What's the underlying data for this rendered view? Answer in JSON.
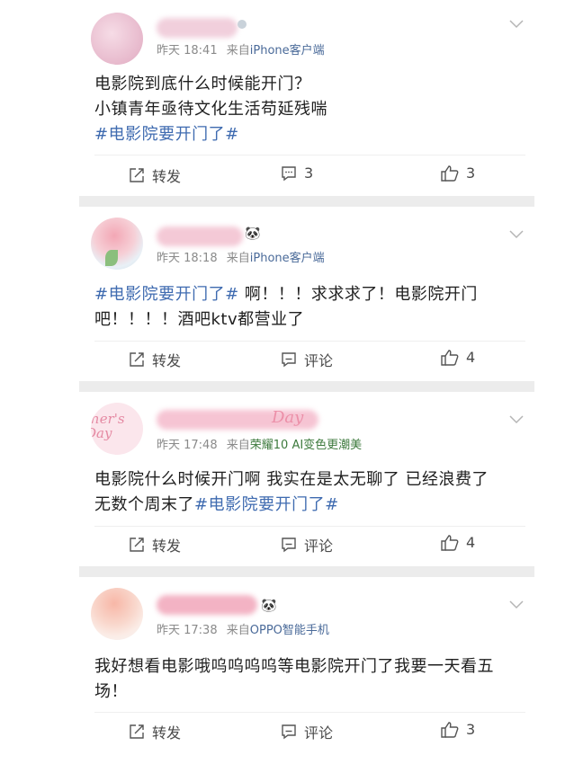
{
  "posts": [
    {
      "time": "昨天 18:41",
      "source_prefix": "来自",
      "source": "iPhone客户端",
      "content_lines": [
        "电影院到底什么时候能开门？",
        "小镇青年亟待文化生活苟延残喘"
      ],
      "hashtag": "#电影院要开门了#",
      "share_label": "转发",
      "comment_label": "3",
      "like_count": "3"
    },
    {
      "time": "昨天 18:18",
      "source_prefix": "来自",
      "source": "iPhone客户端",
      "hashtag": "#电影院要开门了#",
      "content_after_tag": " 啊！！！求求求了！电影院开门",
      "content_line2": "吧！！！！酒吧ktv都营业了",
      "name_badge": "🐼",
      "share_label": "转发",
      "comment_label": "评论",
      "like_count": "4"
    },
    {
      "time": "昨天 17:48",
      "source_prefix": "来自",
      "source": "荣耀10 AI变色更潮美",
      "avatar_text": "ther's Day",
      "name_deco": "Day",
      "content_line1": "电影院什么时候开门啊 我实在是太无聊了 已经浪费了",
      "content_line2_prefix": "无数个周末了",
      "hashtag": "#电影院要开门了#",
      "share_label": "转发",
      "comment_label": "评论",
      "like_count": "4"
    },
    {
      "time": "昨天 17:38",
      "source_prefix": "来自",
      "source": "OPPO智能手机",
      "name_badge": "🐼",
      "content_line1": "我好想看电影哦呜呜呜呜等电影院开门了我要一天看五",
      "content_line2": "场！",
      "share_label": "转发",
      "comment_label": "评论",
      "like_count": "3"
    }
  ],
  "colors": {
    "hashtag": "#3f6bb0",
    "meta": "#8a8a8a",
    "separator": "#ececec"
  },
  "icons": [
    "share-icon",
    "comment-icon",
    "like-icon",
    "chevron-down-icon"
  ]
}
